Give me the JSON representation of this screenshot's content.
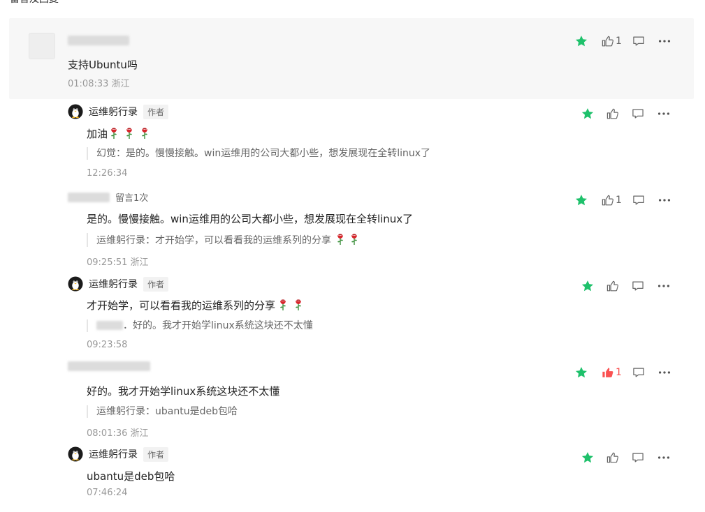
{
  "page": {
    "section_label": "留言及回复"
  },
  "colors": {
    "star": "#1ec16b",
    "like_active": "#fa5151",
    "muted": "#999999",
    "quote_bar": "#e5e5e5"
  },
  "comments": [
    {
      "author": "",
      "text": "支持Ubuntu吗",
      "meta": "01:08:33 浙江",
      "likes": "1"
    },
    {
      "author": "运维躬行录",
      "author_tag": "作者",
      "text": "加油",
      "quote": "幻觉：是的。慢慢接触。win运维用的公司大都小些，想发展现在全转linux了",
      "meta": "12:26:34",
      "likes": ""
    },
    {
      "author": "",
      "author_tag": "留言1次",
      "text": "是的。慢慢接触。win运维用的公司大都小些，想发展现在全转linux了",
      "quote": "运维躬行录：才开始学，可以看看我的运维系列的分享",
      "meta": "09:25:51 浙江",
      "likes": "1"
    },
    {
      "author": "运维躬行录",
      "author_tag": "作者",
      "text": "才开始学，可以看看我的运维系列的分享",
      "quote": "．好的。我才开始学linux系统这块还不太懂",
      "meta": "09:23:58",
      "likes": ""
    },
    {
      "author": "",
      "text": "好的。我才开始学linux系统这块还不太懂",
      "quote": "运维躬行录：ubantu是deb包哈",
      "meta": "08:01:36 浙江",
      "likes": "1"
    },
    {
      "author": "运维躬行录",
      "author_tag": "作者",
      "text": "ubantu是deb包哈",
      "meta": "07:46:24",
      "likes": ""
    }
  ],
  "icons": [
    "star-icon",
    "thumbs-up-icon",
    "comment-icon",
    "more-icon",
    "penguin-avatar-icon",
    "rose-emoji-icon"
  ]
}
